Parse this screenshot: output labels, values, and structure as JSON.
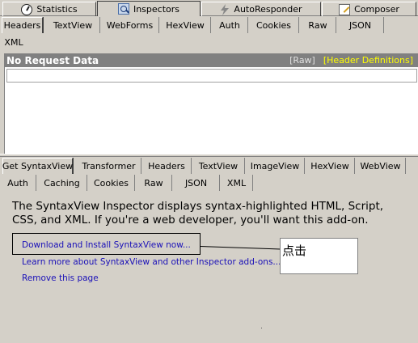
{
  "main_tabs": [
    {
      "label": "Statistics",
      "icon": "stopwatch-icon"
    },
    {
      "label": "Inspectors",
      "icon": "inspector-icon",
      "active": true
    },
    {
      "label": "AutoResponder",
      "icon": "lightning-icon"
    },
    {
      "label": "Composer",
      "icon": "compose-icon"
    }
  ],
  "request_tabs": [
    "Headers",
    "TextView",
    "WebForms",
    "HexView",
    "Auth",
    "Cookies",
    "Raw",
    "JSON",
    "XML"
  ],
  "request_panel": {
    "title": "No Request Data",
    "raw_link": "[Raw]",
    "header_definitions_link": "[Header Definitions]"
  },
  "response_tabs": [
    "Get SyntaxView",
    "Transformer",
    "Headers",
    "TextView",
    "ImageView",
    "HexView",
    "WebView",
    "Auth",
    "Caching",
    "Cookies",
    "Raw",
    "JSON",
    "XML"
  ],
  "content": {
    "description": "The SyntaxView Inspector displays syntax-highlighted HTML, Script, CSS, and XML. If you're a web developer, you'll want this add-on.",
    "download_link": "Download and Install SyntaxView now...",
    "learn_more_link": "Learn more about SyntaxView and other Inspector add-ons...",
    "remove_link": "Remove this page"
  },
  "annotation": {
    "text": "点击"
  },
  "colors": {
    "background": "#d4d0c8",
    "link": "#1a10b8",
    "header_bar": "#808080",
    "header_definitions": "#ffff00"
  }
}
